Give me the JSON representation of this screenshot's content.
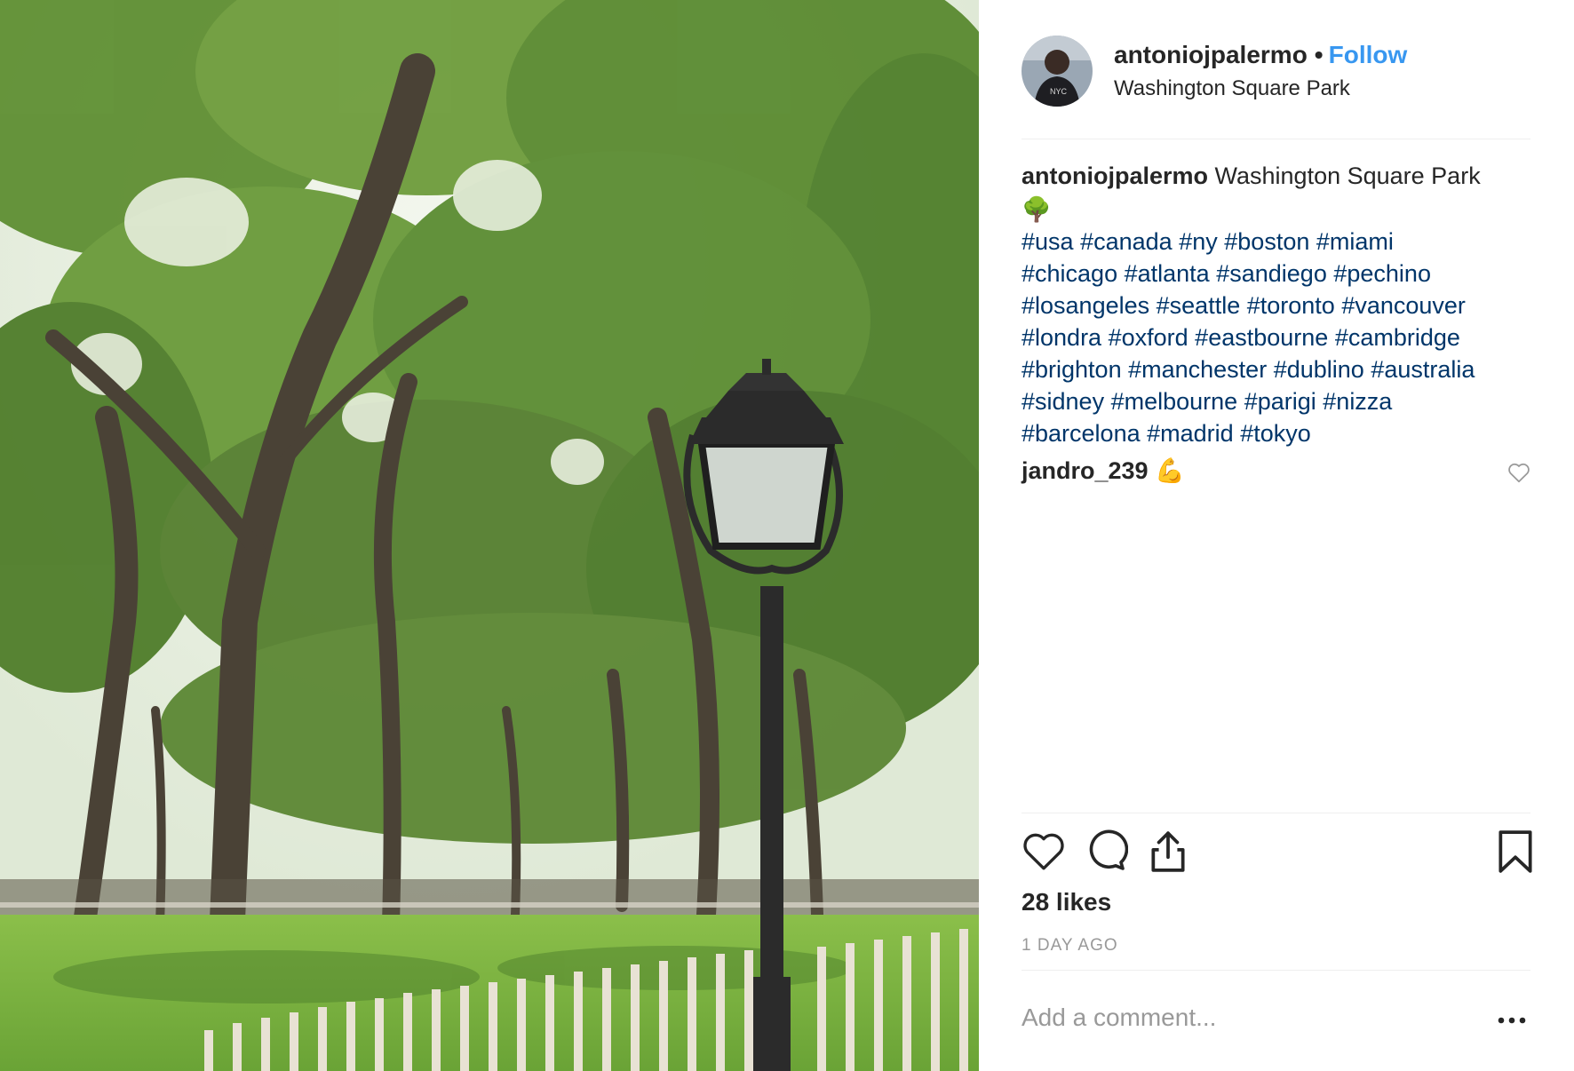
{
  "post": {
    "username": "antoniojpalermo",
    "follow_label": "Follow",
    "location": "Washington Square Park"
  },
  "caption": {
    "author": "antoniojpalermo",
    "text": "Washington Square Park",
    "emoji": "🌳",
    "hashtags": [
      "#usa",
      "#canada",
      "#ny",
      "#boston",
      "#miami",
      "#chicago",
      "#atlanta",
      "#sandiego",
      "#pechino",
      "#losangeles",
      "#seattle",
      "#toronto",
      "#vancouver",
      "#londra",
      "#oxford",
      "#eastbourne",
      "#cambridge",
      "#brighton",
      "#manchester",
      "#dublino",
      "#australia",
      "#sidney",
      "#melbourne",
      "#parigi",
      "#nizza",
      "#barcelona",
      "#madrid",
      "#tokyo"
    ]
  },
  "comment": {
    "username": "jandro_239",
    "emoji": "💪"
  },
  "likes_text": "28 likes",
  "timestamp": "1 DAY AGO",
  "add_comment_placeholder": "Add a comment...",
  "colors": {
    "follow": "#3897f0",
    "hashtag": "#003569",
    "muted": "#999999",
    "text": "#262626"
  },
  "icons": [
    "heart-icon",
    "comment-icon",
    "share-icon",
    "bookmark-icon",
    "more-icon",
    "like-comment-icon"
  ]
}
